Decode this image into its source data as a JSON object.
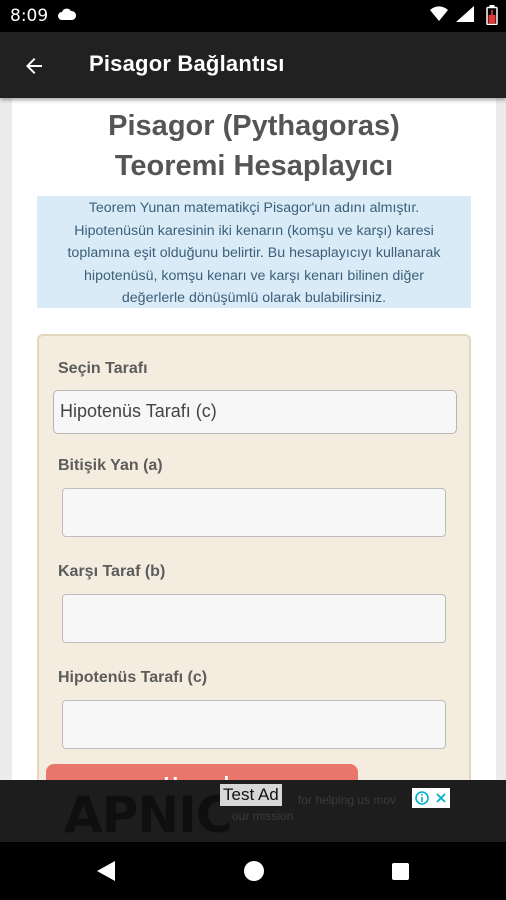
{
  "status_bar": {
    "time": "8:09",
    "icons": [
      "cloud-icon",
      "wifi-icon",
      "signal-icon",
      "battery-icon"
    ]
  },
  "app_bar": {
    "back_icon": "arrow-left-icon",
    "title": "Pisagor Bağlantısı"
  },
  "main": {
    "title_line1": "Pisagor (Pythagoras)",
    "title_line2": "Teoremi Hesaplayıcı",
    "info_lines": [
      "Teorem Yunan matematikçi Pisagor'un adını almıştır.",
      "Hipotenüsün karesinin iki kenarın (komşu ve karşı) karesi",
      "toplamına eşit olduğunu belirtir. Bu hesaplayıcıyı kullanarak",
      "hipotenüsü, komşu kenarı ve karşı kenarı bilinen diğer",
      "değerlerle dönüşümlü olarak bulabilirsiniz."
    ],
    "form": {
      "select_label": "Seçin Tarafı",
      "select_value": "Hipotenüs Tarafı (c)",
      "fields": [
        {
          "label": "Bitişik Yan (a)",
          "value": ""
        },
        {
          "label": "Karşı Taraf (b)",
          "value": ""
        },
        {
          "label": "Hipotenüs Tarafı (c)",
          "value": ""
        }
      ]
    },
    "calculate_label": "Hesapla"
  },
  "ad": {
    "label": "Test Ad",
    "logo": "APNIC",
    "text_line1": "for helping us mov",
    "text_line2": "our mission",
    "choices_icon": "ad-choices-icon",
    "close_icon": "close-icon"
  },
  "colors": {
    "app_bar": "#212121",
    "info_bg": "#d9ebf7",
    "form_bg": "#f4eddf",
    "button": "#e9766a"
  }
}
